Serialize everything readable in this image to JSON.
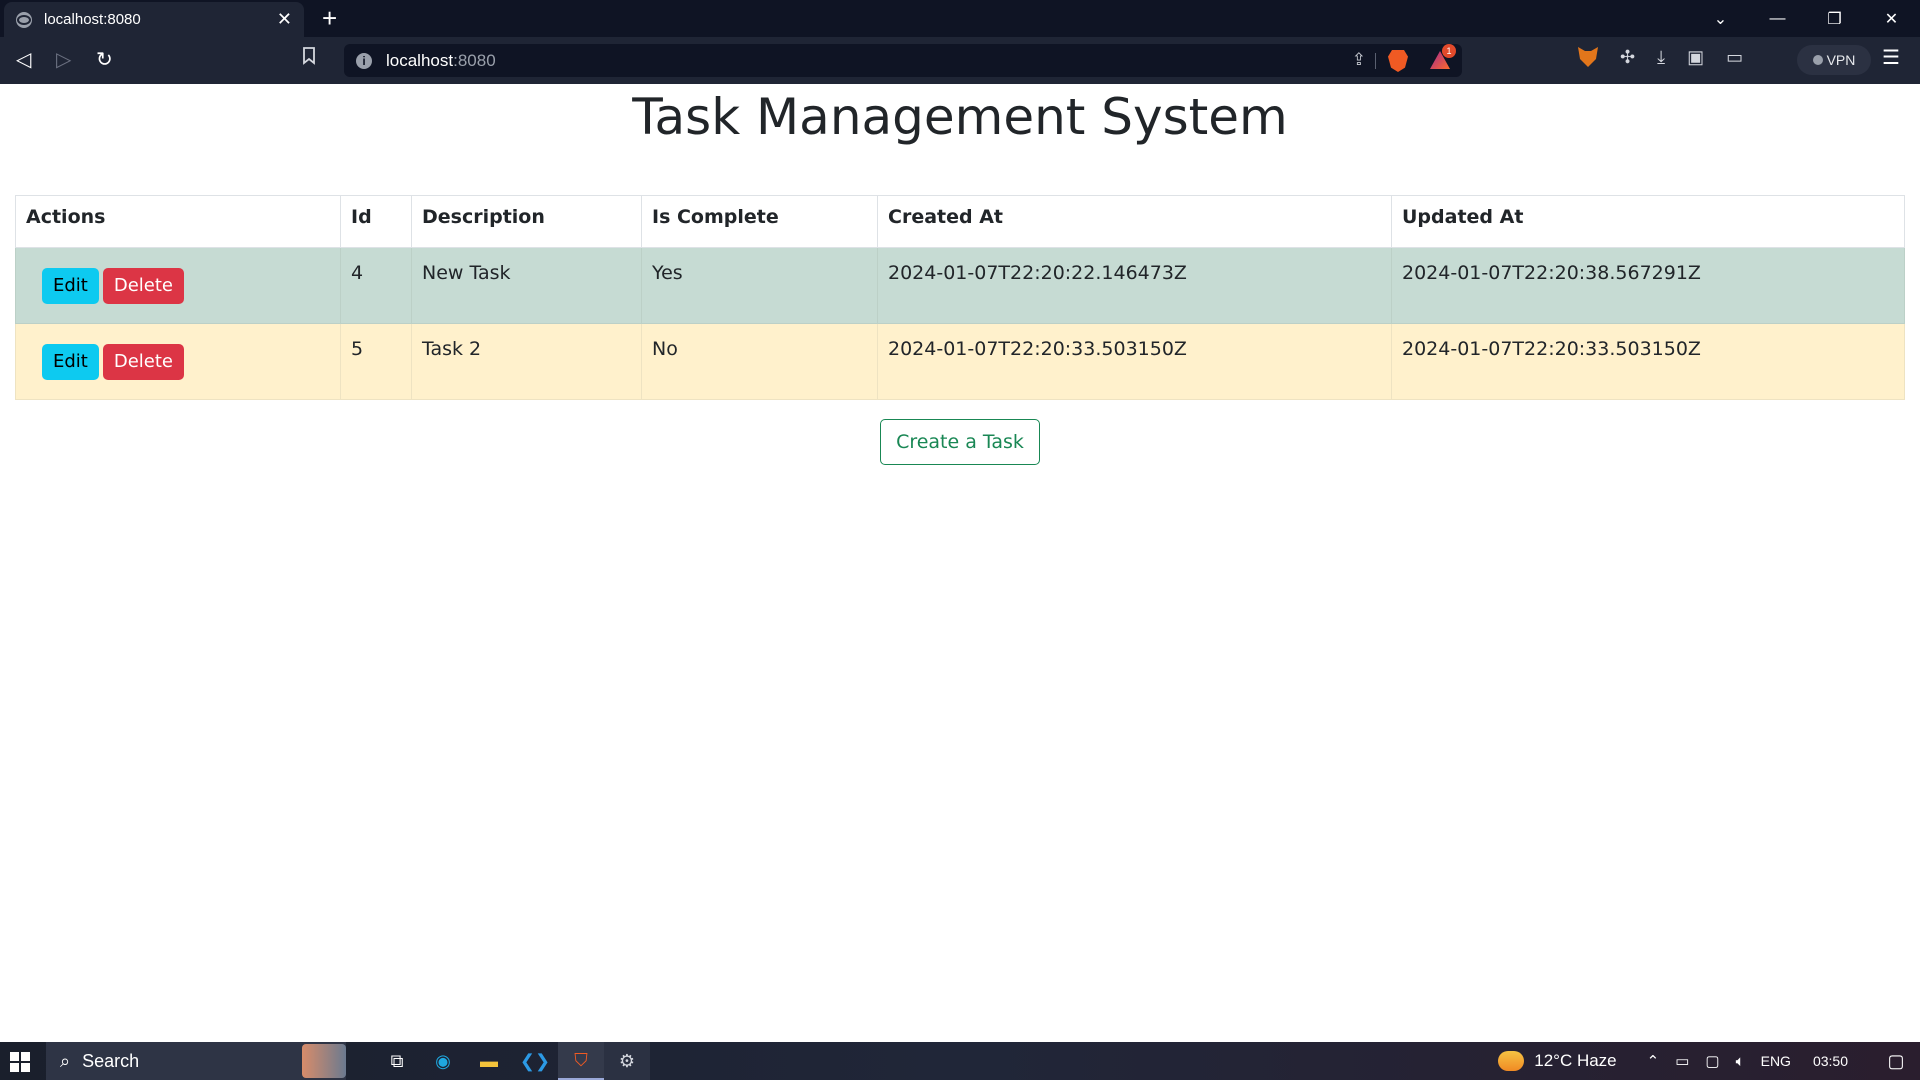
{
  "browser": {
    "tab_title": "localhost:8080",
    "tab_close": "✕",
    "new_tab": "+",
    "url_host": "localhost",
    "url_port": ":8080",
    "win_controls": {
      "dropdown": "⌄",
      "minimize": "—",
      "restore": "❐",
      "close": "✕"
    },
    "nav": {
      "back": "◁",
      "forward": "▷",
      "reload": "↻",
      "bookmark": "🔖"
    },
    "rewards_badge": "1",
    "vpn_label": "VPN",
    "menu": "☰"
  },
  "page": {
    "title": "Task Management System",
    "table": {
      "headers": [
        "Actions",
        "Id",
        "Description",
        "Is Complete",
        "Created At",
        "Updated At"
      ],
      "rows": [
        {
          "id": "4",
          "description": "New Task",
          "is_complete": "Yes",
          "created_at": "2024-01-07T22:20:22.146473Z",
          "updated_at": "2024-01-07T22:20:38.567291Z",
          "edit_label": "Edit",
          "delete_label": "Delete"
        },
        {
          "id": "5",
          "description": "Task 2",
          "is_complete": "No",
          "created_at": "2024-01-07T22:20:33.503150Z",
          "updated_at": "2024-01-07T22:20:33.503150Z",
          "edit_label": "Edit",
          "delete_label": "Delete"
        }
      ]
    },
    "create_button": "Create a Task"
  },
  "taskbar": {
    "search_label": "Search",
    "weather_temp": "12°C  Haze",
    "lang": "ENG",
    "time": "03:50"
  },
  "colors": {
    "row_complete": "#c6dbd3",
    "row_incomplete": "#fff1cc",
    "edit_button": "#0dcaf0",
    "delete_button": "#dc3545",
    "create_button_border": "#198754"
  }
}
